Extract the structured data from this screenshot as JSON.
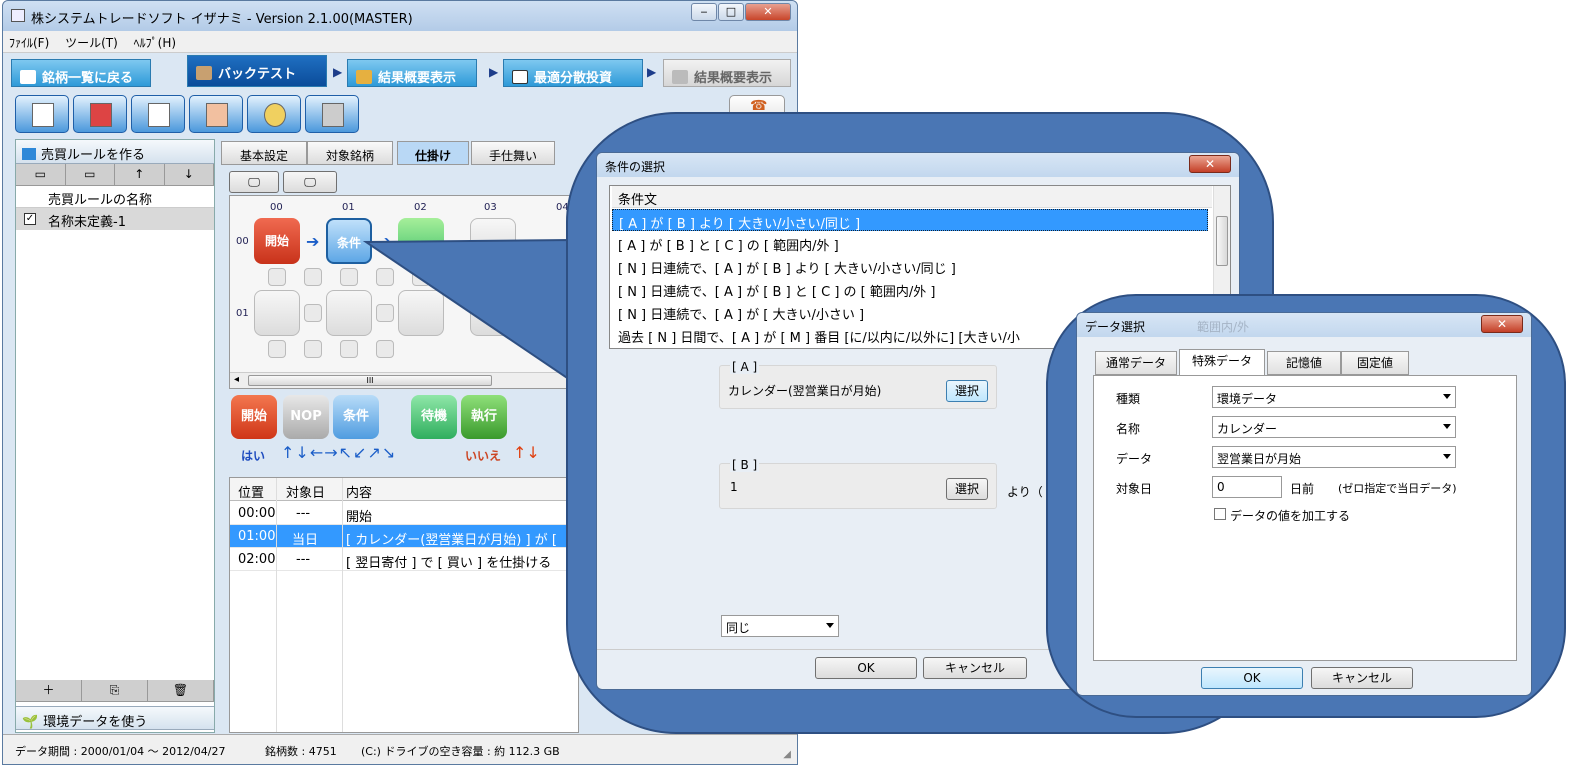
{
  "window": {
    "title": "株システムトレードソフト イザナミ - Version 2.1.00(MASTER)",
    "minimize": "‒",
    "maximize": "□",
    "close": "✕"
  },
  "menu": [
    "ﾌｧｲﾙ(F)",
    "ツール(T)",
    "ﾍﾙﾌﾟ(H)"
  ],
  "nav": {
    "back": "銘柄一覧に戻る",
    "backtest": "バックテスト",
    "summary": "結果概要表示",
    "optimize": "最適分散投資",
    "summary2": "結果概要表示"
  },
  "left": {
    "header": "売買ルールを作る",
    "col_name": "売買ルールの名称",
    "rule_name": "名称未定義-1",
    "footer": "環境データを使う",
    "toolbar": [
      "▭",
      "▭",
      "↑",
      "↓"
    ],
    "bottom_toolbar": [
      "＋",
      "⎘",
      "🗑"
    ]
  },
  "tabs": [
    "基本設定",
    "対象銘柄",
    "仕掛け",
    "手仕舞い"
  ],
  "grid": {
    "cols": [
      "00",
      "01",
      "02",
      "03",
      "04"
    ],
    "rows": [
      "00",
      "01"
    ],
    "node_start": "開始",
    "node_cond": "条件",
    "hscroll": "III"
  },
  "palette": {
    "start": "開始",
    "nop": "NOP",
    "cond": "条件",
    "wait": "待機",
    "exec": "執行",
    "yes": "はい",
    "no": "いいえ"
  },
  "steps": {
    "headers": [
      "位置",
      "対象日",
      "内容"
    ],
    "rows": [
      {
        "pos": "00:00",
        "day": "---",
        "content": "開始"
      },
      {
        "pos": "01:00",
        "day": "当日",
        "content": "[ カレンダー(翌営業日が月始) ] が [ "
      },
      {
        "pos": "02:00",
        "day": "---",
        "content": "[ 翌日寄付 ] で [ 買い ] を仕掛ける"
      }
    ]
  },
  "status": {
    "period": "データ期間 : 2000/01/04 ～ 2012/04/27",
    "count": "銘柄数 : 4751",
    "disk": "(C:) ドライブの空き容量 : 約 112.3 GB"
  },
  "dialog1": {
    "title": "条件の選択",
    "list_header": "条件文",
    "items": [
      "[ A ] が [ B ] より [ 大きい/小さい/同じ ]",
      "[ A ] が [ B ] と [ C ] の [ 範囲内/外 ]",
      "[ N ] 日連続で、[ A ] が [ B ] より [ 大きい/小さい/同じ ]",
      "[ N ] 日連続で、[ A ] が [ B ] と [ C ] の [ 範囲内/外 ]",
      "[ N ] 日連続で、[ A ] が [ 大きい/小さい ]",
      "過去 [ N ] 日間で、[ A ] が [ M ] 番目 [に/以内に/以外に] [大きい/小"
    ],
    "groupA_label": "[ A ]",
    "groupA_value": "カレンダー(翌営業日が月始)",
    "groupB_label": "[ B ]",
    "groupB_value": "1",
    "select_button": "選択",
    "yori": "より（",
    "compare_value": "同じ",
    "ok": "OK",
    "cancel": "キャンセル"
  },
  "dialog2": {
    "title": "データ選択",
    "title_ghost": "範囲内/外",
    "tabs": [
      "通常データ",
      "特殊データ",
      "記憶値",
      "固定値"
    ],
    "kind_label": "種類",
    "kind_value": "環境データ",
    "name_label": "名称",
    "name_value": "カレンダー",
    "data_label": "データ",
    "data_value": "翌営業日が月始",
    "day_label": "対象日",
    "day_value": "0",
    "day_suffix": "日前",
    "day_note": "(ゼロ指定で当日データ)",
    "process_label": "データの値を加工する",
    "ok": "OK",
    "cancel": "キャンセル"
  },
  "colors": {
    "accent_blue": "#4a76b4",
    "selection": "#3399ff",
    "start_red": "#e0452a",
    "cond_blue": "#5ea7e6",
    "wait_green": "#3fbf6a"
  }
}
